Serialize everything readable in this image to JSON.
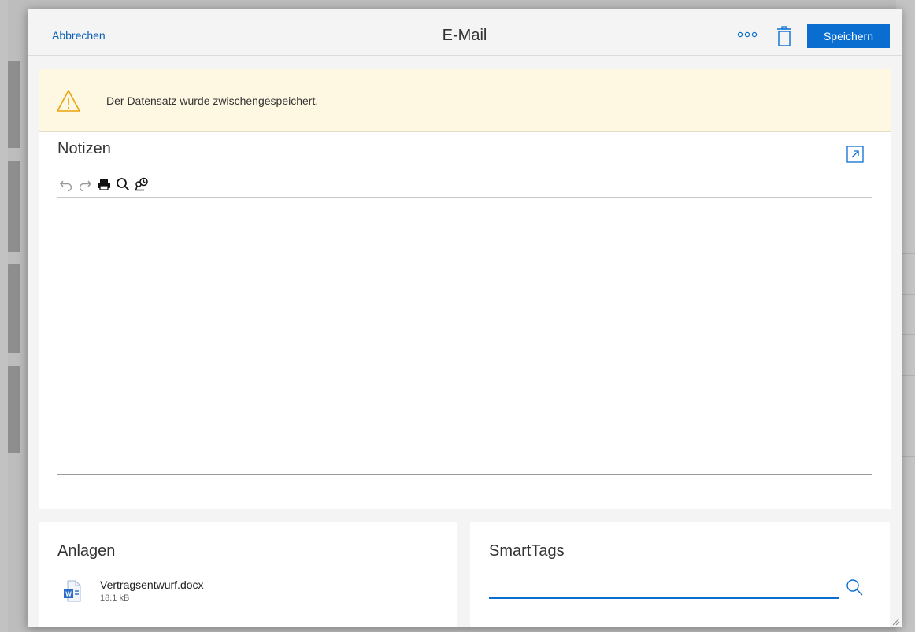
{
  "header": {
    "cancel_label": "Abbrechen",
    "title": "E-Mail",
    "save_label": "Speichern"
  },
  "warning": {
    "message": "Der Datensatz wurde zwischengespeichert."
  },
  "notes": {
    "title": "Notizen",
    "content": ""
  },
  "attachments": {
    "title": "Anlagen",
    "files": [
      {
        "name": "Vertragsentwurf.docx",
        "size": "18.1 kB",
        "icon": "word-file-icon"
      }
    ]
  },
  "smarttags": {
    "title": "SmartTags",
    "value": ""
  },
  "colors": {
    "accent": "#0a6ed1",
    "warning_bg": "#fef7e1",
    "warning_icon": "#e9a30c",
    "backdrop": "#bdbdbd"
  }
}
